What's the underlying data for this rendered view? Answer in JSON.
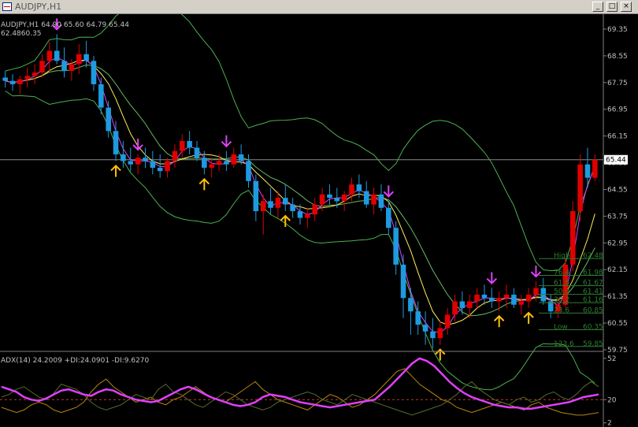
{
  "window": {
    "title": "AUDJPY,H1",
    "buttons": {
      "minimize": "_",
      "maximize": "□",
      "close": "×"
    }
  },
  "chart_data": {
    "type": "candlestick",
    "symbol_line": "AUDJPY,H1  64.90 65.60 64.79 65.44",
    "sub_line": "62.4860.35",
    "yaxis": {
      "ticks": [
        "69.35",
        "68.55",
        "67.75",
        "66.95",
        "66.15",
        "65.35",
        "64.55",
        "63.75",
        "62.95",
        "62.15",
        "61.35",
        "60.55",
        "59.75"
      ],
      "range": [
        59.75,
        69.75
      ],
      "current_price": "65.44"
    },
    "colors": {
      "bull": "#e00000",
      "bear": "#1e9be0",
      "bands": "#4caf50",
      "ma_fast": "#e040fb",
      "ma_mid": "#ffee58",
      "ma_slow": "#66bb6a",
      "arrow_down": "#e040fb",
      "arrow_up": "#ffc107",
      "current_line": "#8a8a8a"
    },
    "candles": [
      [
        67.9,
        68.1,
        67.6,
        67.8
      ],
      [
        67.8,
        68.0,
        67.5,
        67.7
      ],
      [
        67.7,
        67.95,
        67.4,
        67.85
      ],
      [
        67.85,
        68.2,
        67.6,
        67.95
      ],
      [
        67.95,
        68.3,
        67.7,
        68.05
      ],
      [
        68.05,
        68.6,
        67.9,
        68.4
      ],
      [
        68.4,
        68.95,
        68.1,
        68.7
      ],
      [
        68.7,
        69.2,
        68.3,
        68.4
      ],
      [
        68.4,
        68.8,
        67.9,
        68.1
      ],
      [
        68.1,
        68.45,
        67.8,
        68.3
      ],
      [
        68.3,
        68.9,
        68.0,
        68.6
      ],
      [
        68.6,
        69.0,
        68.2,
        68.4
      ],
      [
        68.4,
        68.55,
        67.5,
        67.7
      ],
      [
        67.7,
        67.9,
        66.8,
        67.0
      ],
      [
        67.0,
        67.2,
        66.1,
        66.3
      ],
      [
        66.3,
        66.6,
        65.4,
        65.6
      ],
      [
        65.6,
        66.0,
        65.2,
        65.4
      ],
      [
        65.4,
        65.8,
        65.1,
        65.3
      ],
      [
        65.3,
        65.6,
        65.0,
        65.5
      ],
      [
        65.5,
        65.8,
        65.2,
        65.4
      ],
      [
        65.4,
        65.7,
        65.0,
        65.2
      ],
      [
        65.2,
        65.6,
        64.9,
        65.1
      ],
      [
        65.1,
        65.5,
        64.9,
        65.4
      ],
      [
        65.4,
        65.9,
        65.2,
        65.7
      ],
      [
        65.7,
        66.2,
        65.5,
        66.0
      ],
      [
        66.0,
        66.3,
        65.6,
        65.8
      ],
      [
        65.8,
        66.0,
        65.4,
        65.5
      ],
      [
        65.5,
        65.7,
        65.0,
        65.2
      ],
      [
        65.2,
        65.5,
        64.9,
        65.3
      ],
      [
        65.3,
        65.6,
        65.1,
        65.4
      ],
      [
        65.4,
        65.7,
        65.1,
        65.3
      ],
      [
        65.3,
        65.8,
        65.2,
        65.6
      ],
      [
        65.6,
        65.9,
        65.3,
        65.4
      ],
      [
        65.4,
        65.6,
        64.6,
        64.8
      ],
      [
        64.8,
        65.0,
        63.6,
        63.9
      ],
      [
        63.9,
        64.4,
        63.2,
        64.2
      ],
      [
        64.2,
        64.6,
        63.8,
        64.0
      ],
      [
        64.0,
        64.5,
        63.7,
        64.3
      ],
      [
        64.3,
        64.7,
        63.9,
        64.1
      ],
      [
        64.1,
        64.3,
        63.7,
        63.9
      ],
      [
        63.9,
        64.1,
        63.5,
        63.7
      ],
      [
        63.7,
        64.0,
        63.4,
        63.8
      ],
      [
        63.8,
        64.3,
        63.6,
        64.1
      ],
      [
        64.1,
        64.6,
        63.9,
        64.4
      ],
      [
        64.4,
        64.7,
        64.1,
        64.3
      ],
      [
        64.3,
        64.6,
        64.0,
        64.2
      ],
      [
        64.2,
        64.5,
        63.9,
        64.4
      ],
      [
        64.4,
        64.9,
        64.2,
        64.7
      ],
      [
        64.7,
        65.0,
        64.3,
        64.5
      ],
      [
        64.5,
        64.8,
        64.0,
        64.1
      ],
      [
        64.1,
        64.6,
        63.8,
        64.4
      ],
      [
        64.4,
        64.7,
        63.9,
        64.0
      ],
      [
        64.0,
        64.2,
        63.2,
        63.4
      ],
      [
        63.4,
        63.6,
        62.0,
        62.3
      ],
      [
        62.3,
        62.6,
        60.7,
        61.3
      ],
      [
        61.3,
        61.6,
        60.2,
        60.9
      ],
      [
        60.9,
        61.2,
        60.2,
        60.5
      ],
      [
        60.5,
        60.9,
        59.9,
        60.3
      ],
      [
        60.3,
        60.7,
        59.8,
        60.1
      ],
      [
        60.1,
        60.6,
        59.9,
        60.4
      ],
      [
        60.4,
        61.0,
        60.2,
        60.8
      ],
      [
        60.8,
        61.4,
        60.6,
        61.2
      ],
      [
        61.2,
        61.5,
        60.8,
        61.0
      ],
      [
        61.0,
        61.4,
        60.7,
        61.2
      ],
      [
        61.2,
        61.6,
        61.0,
        61.4
      ],
      [
        61.4,
        61.7,
        61.1,
        61.3
      ],
      [
        61.3,
        61.6,
        61.0,
        61.2
      ],
      [
        61.2,
        61.5,
        60.9,
        61.3
      ],
      [
        61.3,
        61.7,
        61.0,
        61.4
      ],
      [
        61.4,
        61.6,
        61.0,
        61.1
      ],
      [
        61.1,
        61.4,
        60.8,
        61.2
      ],
      [
        61.2,
        61.6,
        61.0,
        61.4
      ],
      [
        61.4,
        61.8,
        61.2,
        61.6
      ],
      [
        61.6,
        61.9,
        61.1,
        61.2
      ],
      [
        61.2,
        61.4,
        60.7,
        60.9
      ],
      [
        60.9,
        61.3,
        60.7,
        61.1
      ],
      [
        61.1,
        62.5,
        61.0,
        62.3
      ],
      [
        62.3,
        64.2,
        62.1,
        63.9
      ],
      [
        63.9,
        65.6,
        63.6,
        65.3
      ],
      [
        65.3,
        65.8,
        64.6,
        64.9
      ],
      [
        64.9,
        65.6,
        64.79,
        65.44
      ]
    ],
    "arrows_down": [
      7,
      18,
      30,
      52,
      66,
      72
    ],
    "arrows_up": [
      15,
      27,
      38,
      59,
      67,
      71
    ],
    "fib_levels": [
      {
        "label": "High",
        "value": "62.48"
      },
      {
        "label": "76.4",
        "value": "61.98"
      },
      {
        "label": "61.8",
        "value": "61.67"
      },
      {
        "label": "50.0",
        "value": "61.41"
      },
      {
        "label": "38.2",
        "value": "61.16"
      },
      {
        "label": "23.6",
        "value": "60.85"
      },
      {
        "label": "Low",
        "value": "60.35"
      },
      {
        "label": "123.6",
        "value": "59.85"
      }
    ],
    "adx": {
      "label": "ADX(14) 24.2009 +DI:24.0901 -DI:9.6270",
      "ticks": [
        "52",
        "20",
        "2"
      ],
      "level": 20,
      "range": [
        0,
        55
      ],
      "adx": [
        30,
        28,
        26,
        22,
        20,
        19,
        21,
        24,
        27,
        28,
        26,
        24,
        23,
        26,
        28,
        27,
        24,
        22,
        20,
        19,
        18,
        19,
        22,
        25,
        28,
        30,
        28,
        25,
        22,
        20,
        18,
        16,
        15,
        16,
        18,
        22,
        24,
        23,
        22,
        20,
        18,
        17,
        16,
        15,
        14,
        15,
        16,
        17,
        18,
        19,
        20,
        25,
        30,
        36,
        42,
        48,
        52,
        50,
        46,
        40,
        34,
        29,
        25,
        22,
        20,
        18,
        16,
        15,
        14,
        14,
        13,
        13,
        14,
        15,
        16,
        17,
        18,
        20,
        22,
        23,
        24
      ],
      "plus_di": [
        22,
        24,
        28,
        30,
        26,
        22,
        20,
        25,
        32,
        30,
        28,
        24,
        18,
        14,
        12,
        14,
        16,
        20,
        24,
        22,
        20,
        28,
        32,
        26,
        24,
        20,
        16,
        14,
        18,
        22,
        26,
        24,
        20,
        16,
        14,
        12,
        14,
        18,
        20,
        22,
        24,
        26,
        24,
        20,
        18,
        16,
        20,
        24,
        22,
        20,
        18,
        16,
        14,
        12,
        10,
        8,
        10,
        12,
        14,
        16,
        20,
        24,
        30,
        34,
        28,
        24,
        20,
        18,
        16,
        20,
        22,
        18,
        20,
        24,
        26,
        22,
        20,
        24,
        30,
        34,
        30
      ],
      "minus_di": [
        14,
        12,
        10,
        12,
        16,
        18,
        16,
        12,
        10,
        12,
        14,
        18,
        26,
        32,
        36,
        30,
        26,
        22,
        18,
        20,
        22,
        18,
        16,
        20,
        22,
        26,
        30,
        26,
        22,
        20,
        18,
        22,
        26,
        30,
        34,
        28,
        24,
        20,
        18,
        16,
        14,
        12,
        16,
        20,
        24,
        22,
        18,
        14,
        16,
        20,
        24,
        30,
        36,
        42,
        44,
        38,
        32,
        28,
        24,
        20,
        18,
        14,
        12,
        10,
        12,
        14,
        16,
        18,
        16,
        14,
        12,
        16,
        18,
        14,
        12,
        10,
        9,
        8,
        8,
        9,
        10
      ]
    }
  }
}
